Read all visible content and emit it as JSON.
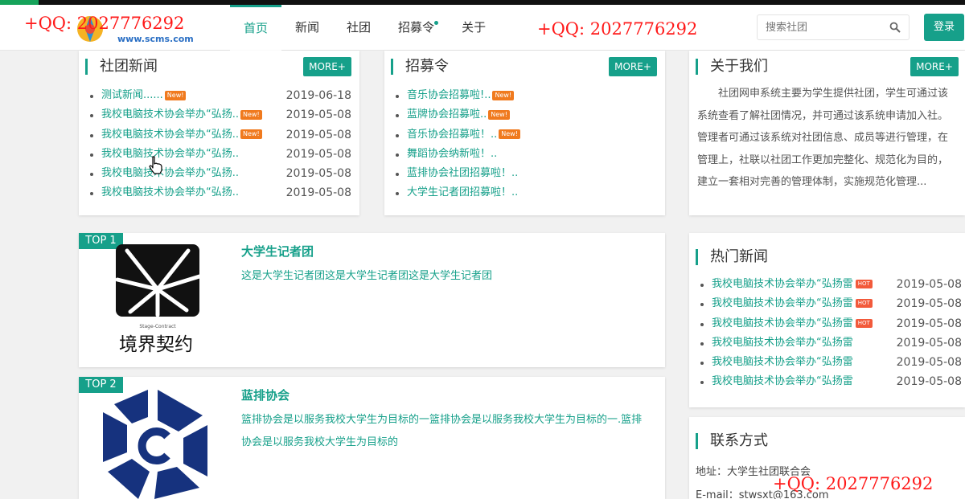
{
  "header": {
    "logo_url": "www.scms.com",
    "nav": [
      {
        "label": "首页",
        "active": true
      },
      {
        "label": "新闻"
      },
      {
        "label": "社团"
      },
      {
        "label": "招募令",
        "dot": true
      },
      {
        "label": "关于"
      }
    ],
    "search_placeholder": "搜索社团",
    "login_label": "登录"
  },
  "club_news": {
    "title": "社团新闻",
    "more": "MORE+",
    "items": [
      {
        "title": "测试新闻......",
        "badge": "New!",
        "date": "2019-06-18"
      },
      {
        "title": "我校电脑技术协会举办“弘扬..",
        "badge": "New!",
        "date": "2019-05-08"
      },
      {
        "title": "我校电脑技术协会举办“弘扬..",
        "badge": "New!",
        "date": "2019-05-08"
      },
      {
        "title": "我校电脑技术协会举办“弘扬..",
        "date": "2019-05-08"
      },
      {
        "title": "我校电脑技术协会举办“弘扬..",
        "date": "2019-05-08"
      },
      {
        "title": "我校电脑技术协会举办“弘扬..",
        "date": "2019-05-08"
      }
    ]
  },
  "recruit": {
    "title": "招募令",
    "more": "MORE+",
    "items": [
      {
        "title": "音乐协会招募啦!..",
        "badge": "New!"
      },
      {
        "title": "蓝牌协会招募啦..",
        "badge": "New!"
      },
      {
        "title": "音乐协会招募啦！..",
        "badge": "New!"
      },
      {
        "title": "舞蹈协会纳新啦！.."
      },
      {
        "title": "蓝排协会社团招募啦！.."
      },
      {
        "title": "大学生记者团招募啦！.."
      }
    ]
  },
  "about": {
    "title": "关于我们",
    "more": "MORE+",
    "text": "社团网申系统主要为学生提供社团，学生可通过该系统查看了解社团情况，并可通过该系统申请加入社。管理者可通过该系统对社团信息、成员等进行管理，在管理上，社联以社团工作更加完整化、规范化为目的，建立一套相对完善的管理体制，实施规范化管理..."
  },
  "top_clubs": [
    {
      "tag": "TOP 1",
      "name": "大学生记者团",
      "desc": "这是大学生记者团这是大学生记者团这是大学生记者团",
      "logo_text": "境界契约",
      "logo_sub": "Stage-Contract"
    },
    {
      "tag": "TOP 2",
      "name": "蓝排协会",
      "desc": "篮排协会是以服务我校大学生为目标的一篮排协会是以服务我校大学生为目标的一.篮排协会是以服务我校大学生为目标的"
    }
  ],
  "hot_news": {
    "title": "热门新闻",
    "items": [
      {
        "title": "我校电脑技术协会举办“弘扬雷",
        "badge": "HOT",
        "date": "2019-05-08"
      },
      {
        "title": "我校电脑技术协会举办“弘扬雷",
        "badge": "HOT",
        "date": "2019-05-08"
      },
      {
        "title": "我校电脑技术协会举办“弘扬雷",
        "badge": "HOT",
        "date": "2019-05-08"
      },
      {
        "title": "我校电脑技术协会举办“弘扬雷",
        "date": "2019-05-08"
      },
      {
        "title": "我校电脑技术协会举办“弘扬雷",
        "date": "2019-05-08"
      },
      {
        "title": "我校电脑技术协会举办“弘扬雷",
        "date": "2019-05-08"
      }
    ]
  },
  "contact": {
    "title": "联系方式",
    "address": "地址：大学生社团联合会",
    "email": "E-mail：stwsxt@163.com"
  },
  "watermarks": [
    "+QQ: 2027776292",
    "+QQ: 2027776292",
    "+QQ: 2027776292"
  ],
  "colors": {
    "accent": "#16a08a",
    "watermark": "#ff1a1a",
    "badge_new": "#f07a1e",
    "badge_hot": "#f25a3b"
  }
}
